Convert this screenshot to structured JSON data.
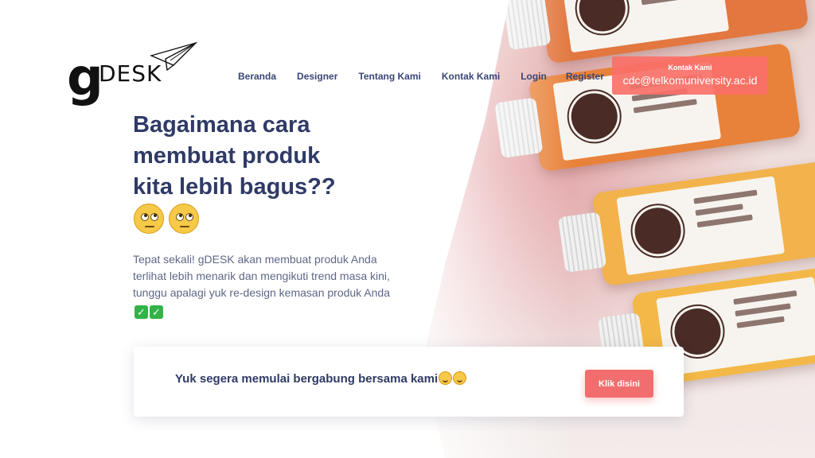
{
  "brand": {
    "logo_letter": "g",
    "logo_word": "DESK"
  },
  "nav": {
    "items": [
      "Beranda",
      "Designer",
      "Tentang Kami",
      "Kontak Kami",
      "Login",
      "Register"
    ]
  },
  "contact": {
    "title": "Kontak Kami",
    "email": "cdc@telkomuniversity.ac.id"
  },
  "hero": {
    "headline": "Bagaimana cara membuat produk kita lebih bagus??",
    "headline_emoji": [
      "face-with-rolling-eyes",
      "face-with-rolling-eyes"
    ],
    "description": "Tepat sekali! gDESK akan membuat produk Anda terlihat lebih menarik dan mengikuti trend masa kini, tunggu apalagi yuk re-design kemasan produk Anda",
    "description_emoji": [
      "check-mark-button",
      "check-mark-button"
    ]
  },
  "cta": {
    "text": "Yuk segera memulai bergabung bersama kami",
    "text_emoji": [
      "smiling-face",
      "smiling-face"
    ],
    "button_label": "Klik disini"
  },
  "colors": {
    "primary_text": "#2f3a66",
    "accent": "#f26d6d",
    "contact_bg": "#fa7068"
  }
}
